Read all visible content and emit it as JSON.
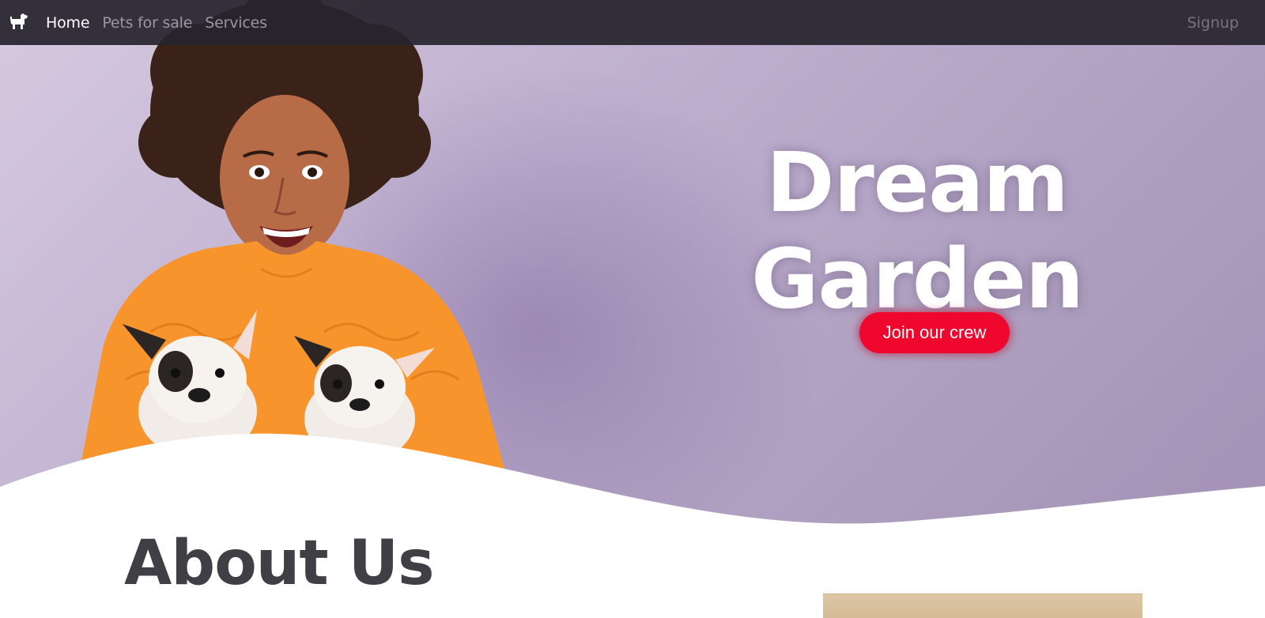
{
  "nav": {
    "brand_icon": "dog-icon",
    "links": [
      {
        "label": "Home",
        "active": true
      },
      {
        "label": "Pets for sale",
        "active": false
      },
      {
        "label": "Services",
        "active": false
      }
    ],
    "signup_label": "Signup"
  },
  "hero": {
    "title": "Dream Garden",
    "cta_label": "Join our crew",
    "colors": {
      "cta": "#f0072e",
      "background": "#bfb0d0",
      "sweater": "#f7952c"
    }
  },
  "about": {
    "title": "About Us"
  }
}
